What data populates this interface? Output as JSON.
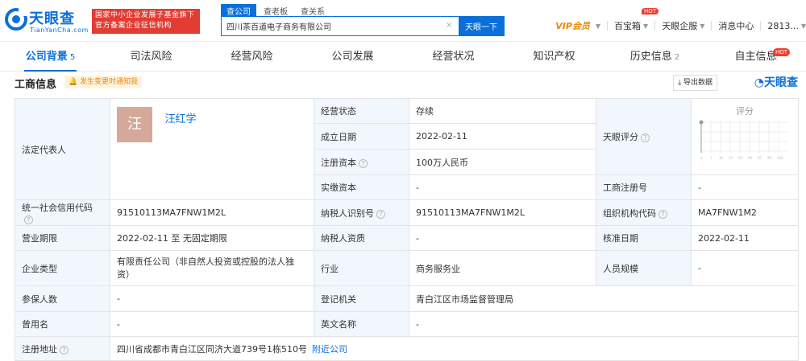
{
  "header": {
    "logo_text": "天眼查",
    "logo_sub": "TianYanCha.com",
    "promo_line1": "国家中小企业发展子基金旗下",
    "promo_line2": "官方备案企业征信机构",
    "search_tabs": [
      "查公司",
      "查老板",
      "查关系"
    ],
    "search_value": "四川茶百道电子商务有限公司",
    "search_button": "天眼一下",
    "clear_icon": "×",
    "vip_label": "VIP会员",
    "treasure_label": "百宝箱",
    "hot_badge": "HOT",
    "enterprise_label": "天眼企服",
    "messages_label": "消息中心",
    "user_label": "2813..."
  },
  "nav": {
    "tabs": [
      {
        "label": "公司背景",
        "count": "5"
      },
      {
        "label": "司法风险",
        "count": ""
      },
      {
        "label": "经营风险",
        "count": ""
      },
      {
        "label": "公司发展",
        "count": ""
      },
      {
        "label": "经营状况",
        "count": ""
      },
      {
        "label": "知识产权",
        "count": ""
      },
      {
        "label": "历史信息",
        "count": "2"
      },
      {
        "label": "自主信息",
        "count": ""
      }
    ],
    "hot_badge": "HOT"
  },
  "section": {
    "title": "工商信息",
    "notify": "发生变更时通知我",
    "export_label": "导出数据",
    "watermark": "天眼查"
  },
  "info": {
    "legal_rep_label": "法定代表人",
    "legal_rep_avatar": "汪",
    "legal_rep_name": "汪红学",
    "status_label": "经营状态",
    "status_value": "存续",
    "founded_label": "成立日期",
    "founded_value": "2022-02-11",
    "reg_capital_label": "注册资本",
    "reg_capital_value": "100万人民币",
    "paid_capital_label": "实缴资本",
    "paid_capital_value": "-",
    "tianyan_score_label": "天眼评分",
    "score_title": "评分",
    "score_ticks": [
      "0",
      "1",
      "10",
      "15",
      "50",
      "65",
      "97",
      "99",
      "100"
    ],
    "biz_reg_no_label": "工商注册号",
    "biz_reg_no_value": "-",
    "credit_code_label": "统一社会信用代码",
    "credit_code_value": "91510113MA7FNW1M2L",
    "taxpayer_id_label": "纳税人识别号",
    "taxpayer_id_value": "91510113MA7FNW1M2L",
    "org_code_label": "组织机构代码",
    "org_code_value": "MA7FNW1M2",
    "term_label": "营业期限",
    "term_value": "2022-02-11 至 无固定期限",
    "taxpayer_qual_label": "纳税人资质",
    "taxpayer_qual_value": "-",
    "approval_date_label": "核准日期",
    "approval_date_value": "2022-02-11",
    "type_label": "企业类型",
    "type_value": "有限责任公司（非自然人投资或控股的法人独资）",
    "industry_label": "行业",
    "industry_value": "商务服务业",
    "staff_scale_label": "人员规模",
    "staff_scale_value": "-",
    "insured_label": "参保人数",
    "insured_value": "-",
    "authority_label": "登记机关",
    "authority_value": "青白江区市场监督管理局",
    "former_name_label": "曾用名",
    "former_name_value": "-",
    "english_name_label": "英文名称",
    "english_name_value": "-",
    "address_label": "注册地址",
    "address_value": "四川省成都市青白江区同济大道739号1栋510号",
    "nearby_link": "附近公司"
  },
  "colors": {
    "brand_blue": "#0a6fdb",
    "promo_red": "#e23c33",
    "vip_orange": "#e8880a",
    "label_bg": "#f2f7fd"
  }
}
